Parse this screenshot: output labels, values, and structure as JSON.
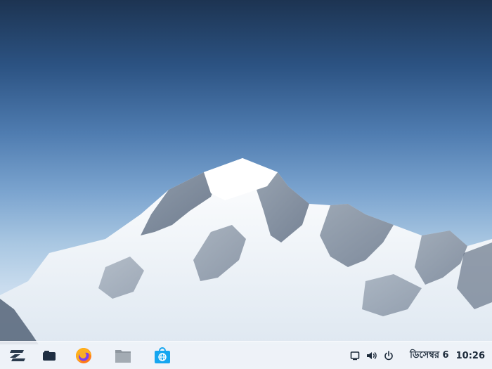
{
  "taskbar": {
    "apps": [
      {
        "name": "Zorin Menu",
        "icon": "zorin-logo-icon"
      },
      {
        "name": "Workspaces",
        "icon": "window-switcher-icon"
      },
      {
        "name": "Firefox",
        "icon": "firefox-icon"
      },
      {
        "name": "Files",
        "icon": "folder-icon"
      },
      {
        "name": "Software",
        "icon": "software-store-icon"
      }
    ],
    "tray": {
      "icons": [
        "screen-icon",
        "volume-icon",
        "power-icon"
      ],
      "date": "ডিসেম্বর 6",
      "time": "10:26"
    }
  },
  "colors": {
    "accent": "#15a6f0",
    "taskbar_text": "#1c2a3a",
    "zorin_logo": "#2a3a4d"
  }
}
